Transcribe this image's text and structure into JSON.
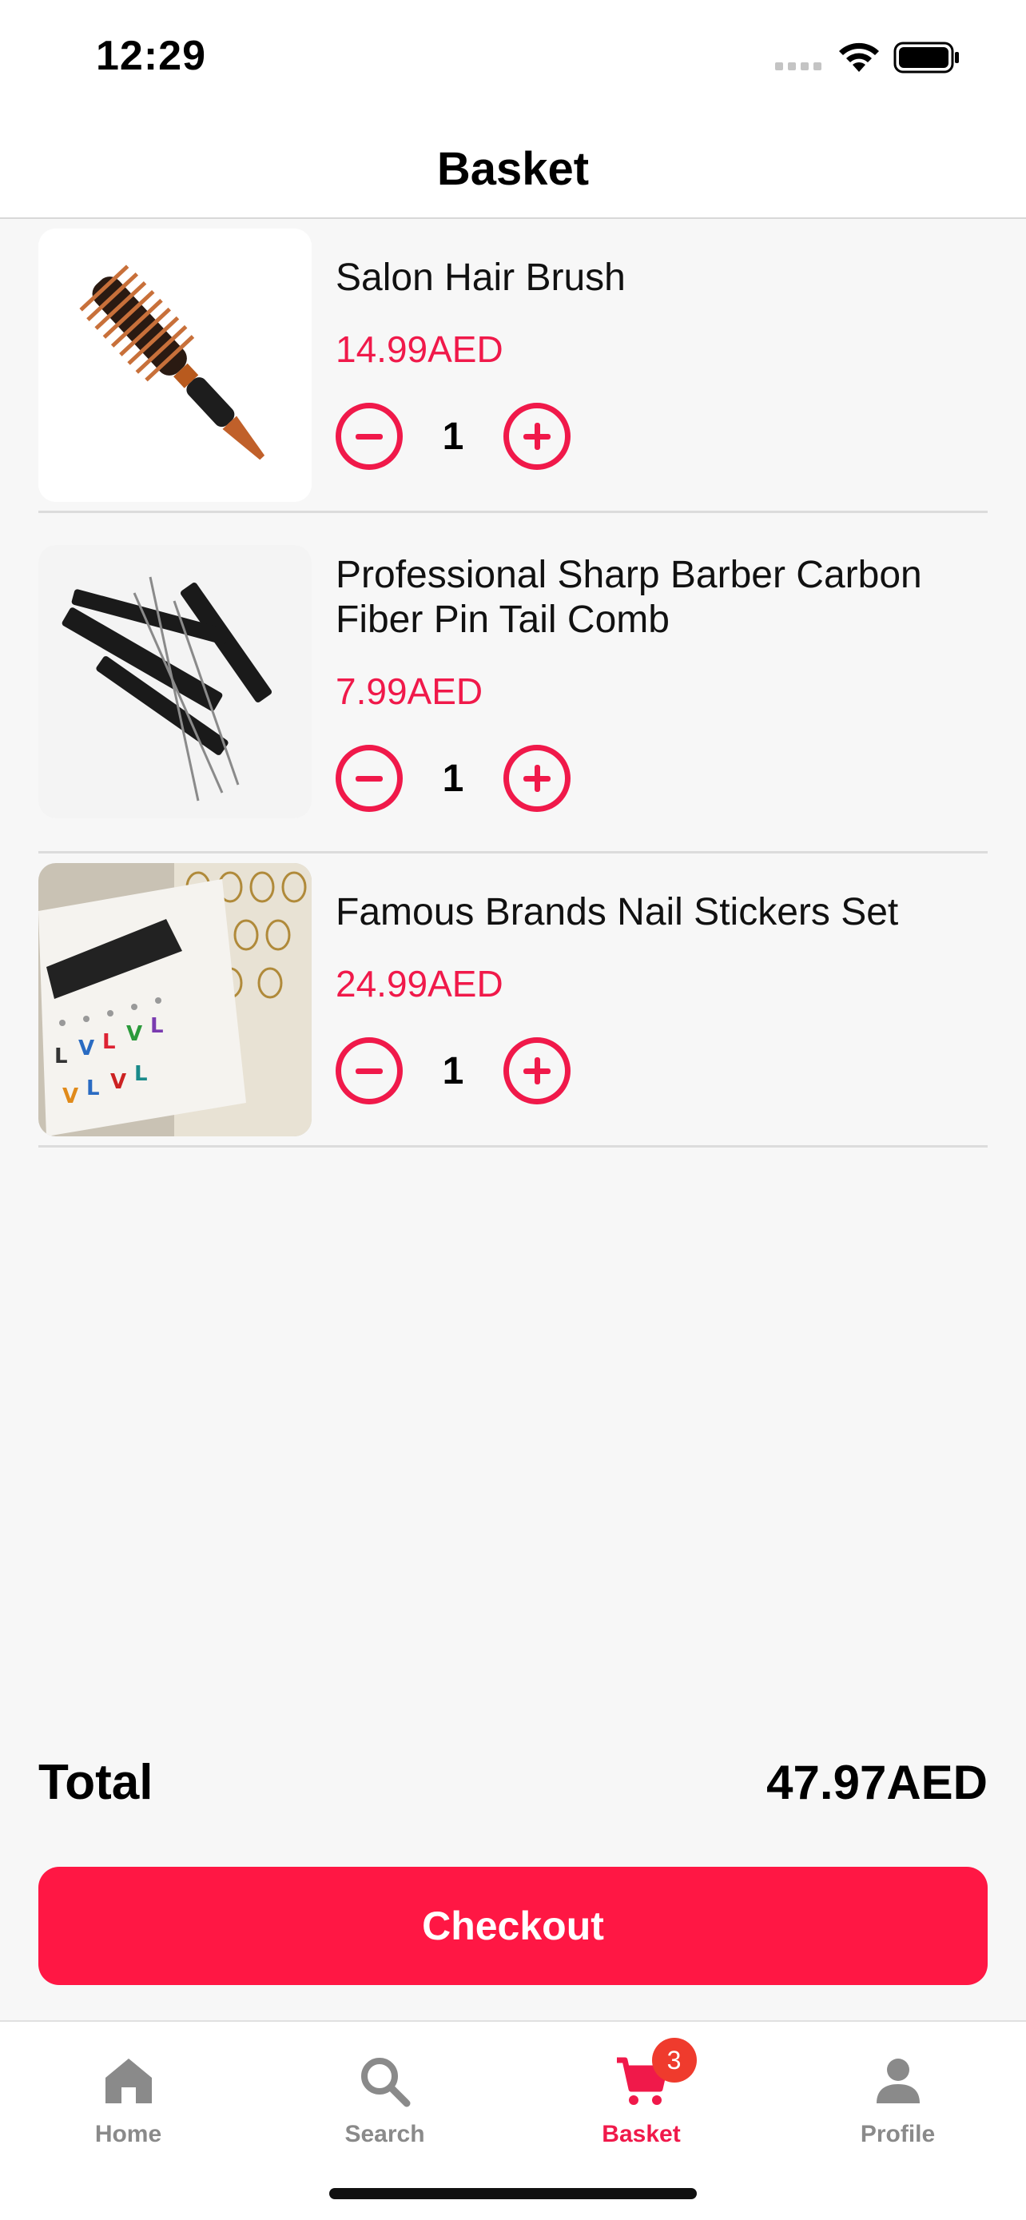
{
  "status_bar": {
    "time": "12:29"
  },
  "header": {
    "title": "Basket"
  },
  "items": [
    {
      "name": "Salon Hair Brush",
      "price": "14.99AED",
      "quantity": "1"
    },
    {
      "name": "Professional Sharp Barber Carbon Fiber Pin Tail Comb",
      "price": "7.99AED",
      "quantity": "1"
    },
    {
      "name": "Famous Brands Nail Stickers Set",
      "price": "24.99AED",
      "quantity": "1"
    }
  ],
  "summary": {
    "total_label": "Total",
    "total_value": "47.97AED"
  },
  "checkout": {
    "label": "Checkout"
  },
  "tabs": [
    {
      "label": "Home",
      "icon": "home-icon"
    },
    {
      "label": "Search",
      "icon": "search-icon"
    },
    {
      "label": "Basket",
      "icon": "cart-icon",
      "badge": "3",
      "active": true
    },
    {
      "label": "Profile",
      "icon": "person-icon"
    }
  ],
  "colors": {
    "accent": "#f0194a",
    "button": "#ff1744",
    "badge": "#ef3b2d",
    "inactive": "#8a8a8a"
  }
}
